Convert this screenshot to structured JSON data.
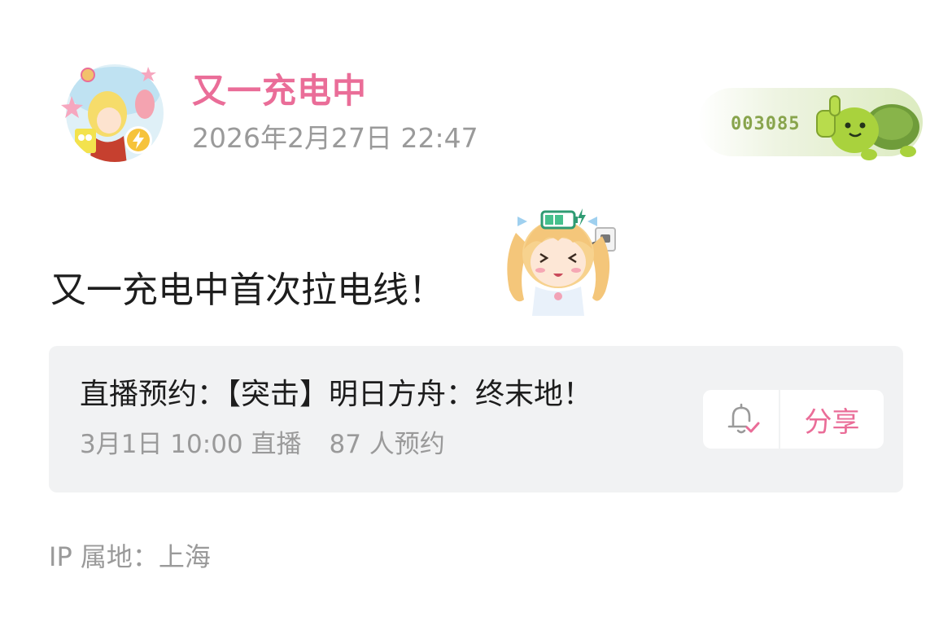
{
  "header": {
    "username": "又一充电中",
    "post_time": "2026年2月27日 22:47",
    "avatar_badge_icon": "lightning-icon",
    "fan_badge": {
      "number": "003085",
      "mascot_icon": "turtle-thumbs-up-icon"
    }
  },
  "post": {
    "text": "又一充电中首次拉电线！",
    "sticker_icon": "charging-girl-sticker"
  },
  "live_card": {
    "title": "直播预约：【突击】明日方舟：终末地！",
    "time": "3月1日 10:00 直播",
    "reservations": "87 人预约",
    "reserve_icon": "bell-check-icon",
    "share_label": "分享"
  },
  "footer": {
    "ip_location": "IP 属地：上海"
  },
  "colors": {
    "accent_pink": "#ea6d98",
    "muted_gray": "#9a9a9a",
    "card_bg": "#f1f2f3",
    "badge_green": "#88a44c"
  }
}
